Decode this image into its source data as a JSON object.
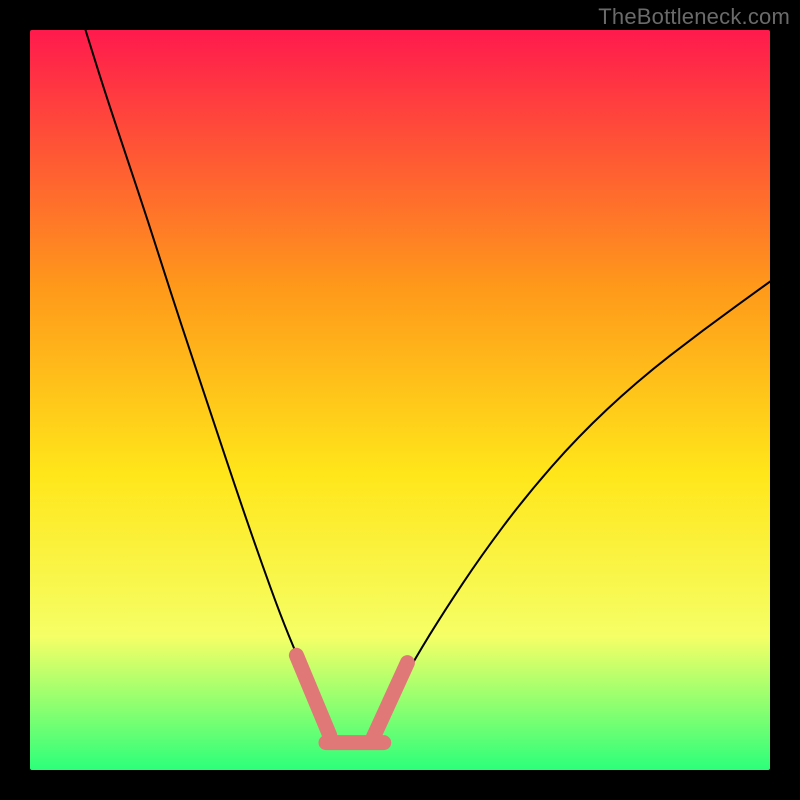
{
  "watermark": {
    "text": "TheBottleneck.com"
  },
  "chart_data": {
    "type": "line",
    "title": "",
    "xlabel": "",
    "ylabel": "",
    "xlim": [
      0,
      1
    ],
    "ylim": [
      0,
      1
    ],
    "grid": false,
    "background_gradient": {
      "top_color": "#ff1a4d",
      "mid_upper_color": "#ff9a1a",
      "mid_color": "#ffe61a",
      "mid_lower_color": "#f5ff66",
      "bottom_color": "#2cff7a"
    },
    "series": [
      {
        "name": "left-branch",
        "type": "line",
        "color": "#000000",
        "stroke_width": 2,
        "x": [
          0.075,
          0.1,
          0.13,
          0.16,
          0.19,
          0.22,
          0.25,
          0.28,
          0.31,
          0.34,
          0.365,
          0.385,
          0.4
        ],
        "y": [
          1.0,
          0.92,
          0.83,
          0.74,
          0.646,
          0.555,
          0.465,
          0.375,
          0.288,
          0.205,
          0.145,
          0.095,
          0.06
        ]
      },
      {
        "name": "right-branch",
        "type": "line",
        "color": "#000000",
        "stroke_width": 2,
        "x": [
          0.47,
          0.49,
          0.52,
          0.56,
          0.61,
          0.67,
          0.74,
          0.82,
          0.91,
          1.0
        ],
        "y": [
          0.055,
          0.095,
          0.15,
          0.215,
          0.29,
          0.37,
          0.45,
          0.525,
          0.595,
          0.66
        ]
      },
      {
        "name": "highlight-segments",
        "type": "line_segments",
        "color": "#e07878",
        "stroke_width": 15,
        "segments": [
          {
            "x1": 0.36,
            "y1": 0.155,
            "x2": 0.405,
            "y2": 0.047
          },
          {
            "x1": 0.4,
            "y1": 0.037,
            "x2": 0.478,
            "y2": 0.037
          },
          {
            "x1": 0.462,
            "y1": 0.04,
            "x2": 0.51,
            "y2": 0.145
          }
        ]
      }
    ]
  }
}
